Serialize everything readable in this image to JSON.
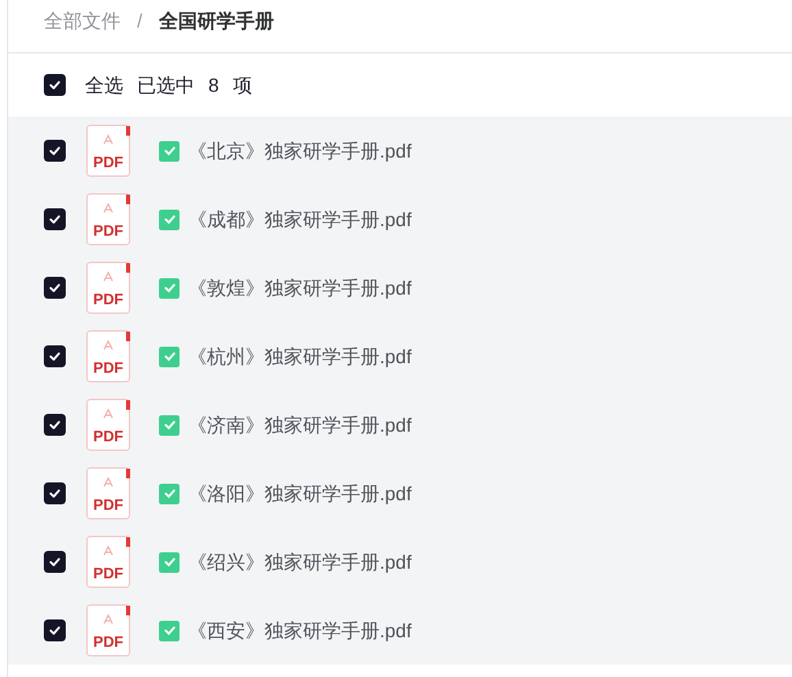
{
  "breadcrumb": [
    {
      "label": "全部文件",
      "current": false
    },
    {
      "label": "全国研学手册",
      "current": true
    }
  ],
  "separator": "/",
  "select_all": {
    "checked": true,
    "label": "全选",
    "status_prefix": "已选中",
    "count": "8",
    "status_suffix": "项"
  },
  "files": [
    {
      "name": "《北京》独家研学手册.pdf",
      "checked": true,
      "badge": "PDF",
      "synced": true
    },
    {
      "name": "《成都》独家研学手册.pdf",
      "checked": true,
      "badge": "PDF",
      "synced": true
    },
    {
      "name": "《敦煌》独家研学手册.pdf",
      "checked": true,
      "badge": "PDF",
      "synced": true
    },
    {
      "name": "《杭州》独家研学手册.pdf",
      "checked": true,
      "badge": "PDF",
      "synced": true
    },
    {
      "name": "《济南》独家研学手册.pdf",
      "checked": true,
      "badge": "PDF",
      "synced": true
    },
    {
      "name": "《洛阳》独家研学手册.pdf",
      "checked": true,
      "badge": "PDF",
      "synced": true
    },
    {
      "name": "《绍兴》独家研学手册.pdf",
      "checked": true,
      "badge": "PDF",
      "synced": true
    },
    {
      "name": "《西安》独家研学手册.pdf",
      "checked": true,
      "badge": "PDF",
      "synced": true
    }
  ]
}
